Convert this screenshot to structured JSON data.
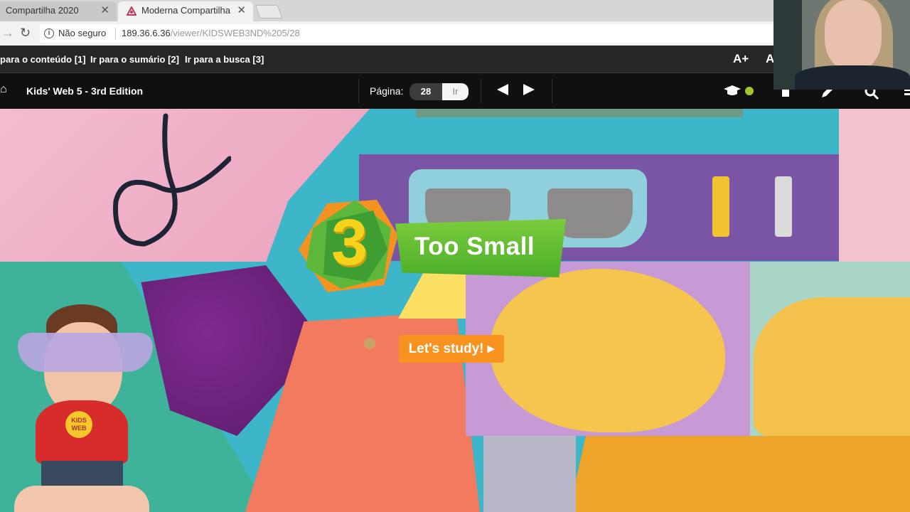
{
  "browser": {
    "tabs": [
      {
        "title": "Compartilha 2020"
      },
      {
        "title": "Moderna Compartilha"
      }
    ],
    "security_label": "Não seguro",
    "url_host": "189.36.6.36",
    "url_path": "/viewer/KIDSWEB3ND%205/28"
  },
  "skipbar": {
    "links": [
      "para o conteúdo [1]",
      "Ir para o sumário [2]",
      "Ir para a busca [3]"
    ],
    "font_increase": "A+",
    "font_decrease": "A"
  },
  "toolbar": {
    "book_title": "Kids' Web 5 - 3rd Edition",
    "page_label": "Página:",
    "page_value": "28",
    "go_label": "Ir"
  },
  "page": {
    "unit_number": "3",
    "unit_title": "Too Small",
    "cta": "Let's study!",
    "mascot_shirt_text": "KIDS WEB"
  },
  "colors": {
    "accent_green": "#4cae2a",
    "accent_orange": "#f7931e",
    "status_dot": "#a4c432"
  }
}
